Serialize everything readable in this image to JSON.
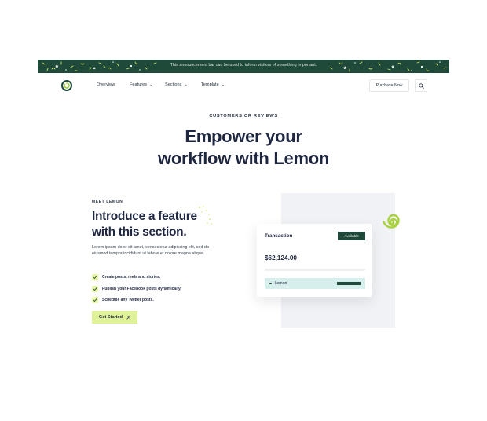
{
  "announcement": {
    "text": "This announcement bar can be used to inform visitors of something important."
  },
  "nav": {
    "items": [
      {
        "label": "Overview",
        "has_dropdown": false
      },
      {
        "label": "Features",
        "has_dropdown": true
      },
      {
        "label": "Sections",
        "has_dropdown": true
      },
      {
        "label": "Template",
        "has_dropdown": true
      }
    ],
    "purchase_label": "Purchase Now",
    "search_icon": "search-icon"
  },
  "hero": {
    "eyebrow": "CUSTOMERS OR REVIEWS",
    "title_line1": "Empower your",
    "title_line2": "workflow with Lemon"
  },
  "feature": {
    "eyebrow": "MEET LEMON",
    "title_line1": "Introduce a feature",
    "title_line2": "with this section.",
    "description": "Lorem ipsum dolor sit amet, consectetur adipiscing elit, sed do eiusmod tempor incididunt ut labore et dolore magna aliqua.",
    "checklist": [
      "Create posts, reels and stories.",
      "Publish your Facebook posts dynamically.",
      "Schedule any Twitter posts."
    ],
    "cta_label": "Get Started",
    "cta_icon": "arrow-up-right-icon"
  },
  "card": {
    "title": "Transaction",
    "badge": "Available",
    "amount": "$62,124.00",
    "row_label": "Lemon"
  },
  "colors": {
    "brand_dark": "#1f4a3a",
    "accent_lime": "#dff29a",
    "row_mint": "#d6efec",
    "heading": "#1f2740"
  }
}
